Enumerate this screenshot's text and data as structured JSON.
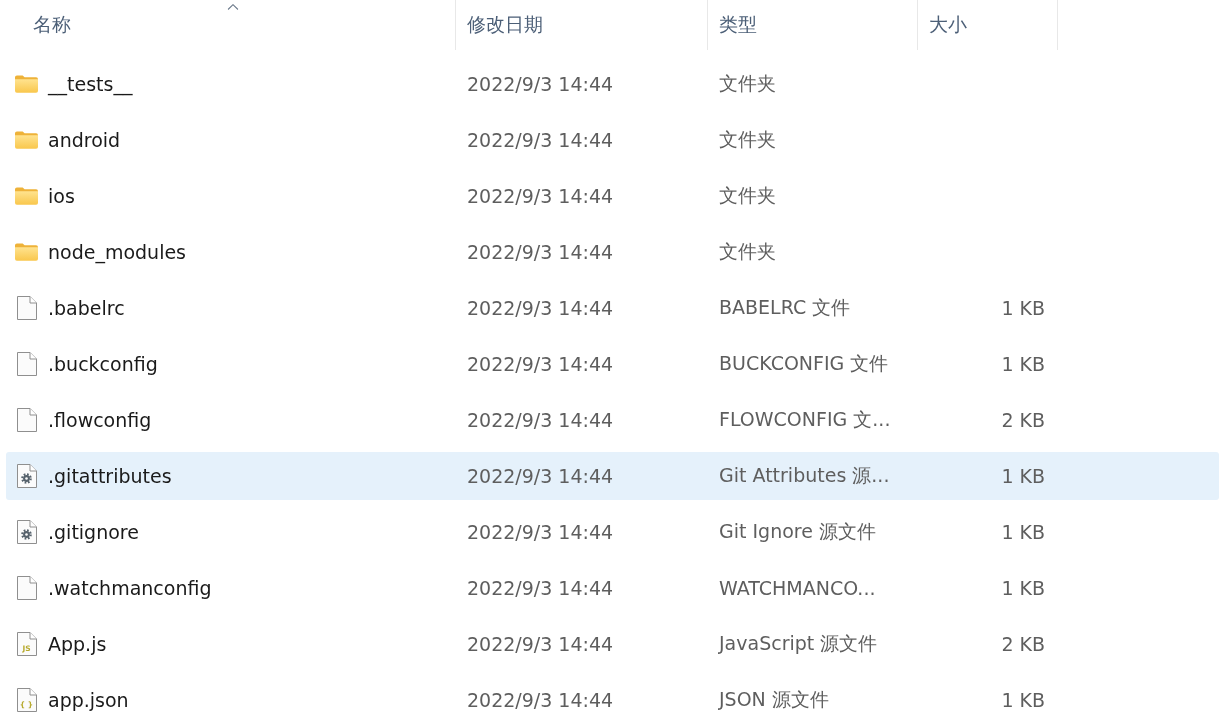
{
  "columns": [
    {
      "label": "名称",
      "sorted": true
    },
    {
      "label": "修改日期",
      "sorted": false
    },
    {
      "label": "类型",
      "sorted": false
    },
    {
      "label": "大小",
      "sorted": false
    }
  ],
  "rows": [
    {
      "kind": "folder",
      "name": "__tests__",
      "modified": "2022/9/3 14:44",
      "type": "文件夹",
      "selected": false
    },
    {
      "kind": "folder",
      "name": "android",
      "modified": "2022/9/3 14:44",
      "type": "文件夹",
      "selected": false
    },
    {
      "kind": "folder",
      "name": "ios",
      "modified": "2022/9/3 14:44",
      "type": "文件夹",
      "selected": false
    },
    {
      "kind": "folder",
      "name": "node_modules",
      "modified": "2022/9/3 14:44",
      "type": "文件夹",
      "selected": false
    },
    {
      "kind": "file",
      "name": ".babelrc",
      "modified": "2022/9/3 14:44",
      "type": "BABELRC 文件",
      "size": "1 KB",
      "selected": false
    },
    {
      "kind": "file",
      "name": ".buckconfig",
      "modified": "2022/9/3 14:44",
      "type": "BUCKCONFIG 文件",
      "size": "1 KB",
      "selected": false
    },
    {
      "kind": "file",
      "name": ".flowconfig",
      "modified": "2022/9/3 14:44",
      "type": "FLOWCONFIG 文...",
      "size": "2 KB",
      "selected": false
    },
    {
      "kind": "settings-file",
      "name": ".gitattributes",
      "modified": "2022/9/3 14:44",
      "type": "Git Attributes 源...",
      "size": "1 KB",
      "selected": true
    },
    {
      "kind": "settings-file",
      "name": ".gitignore",
      "modified": "2022/9/3 14:44",
      "type": "Git Ignore 源文件",
      "size": "1 KB",
      "selected": false
    },
    {
      "kind": "file",
      "name": ".watchmanconfig",
      "modified": "2022/9/3 14:44",
      "type": "WATCHMANCO...",
      "size": "1 KB",
      "selected": false
    },
    {
      "kind": "code-file",
      "icon_text": "JS",
      "name": "App.js",
      "modified": "2022/9/3 14:44",
      "type": "JavaScript 源文件",
      "size": "2 KB",
      "selected": false
    },
    {
      "kind": "code-file",
      "icon_text": "{ }",
      "name": "app.json",
      "modified": "2022/9/3 14:44",
      "type": "JSON 源文件",
      "size": "1 KB",
      "selected": false
    }
  ]
}
